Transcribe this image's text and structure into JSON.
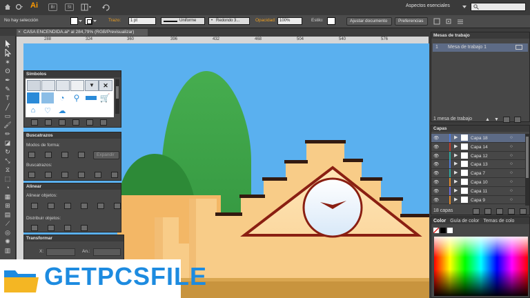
{
  "menubar": {
    "app_label": "Ai",
    "bridge_label": "Br",
    "stock_label": "St",
    "workspace": "Aspectos esenciales",
    "search_icon": "search-icon"
  },
  "control_bar": {
    "selection_status": "No hay selección",
    "stroke_label": "Trazo:",
    "stroke_weight": "1 pt",
    "profile_label": "Uniforme",
    "brush_label": "Redondo 3...",
    "opacity_label": "Opacidad:",
    "opacity_value": "100%",
    "style_label": "Estilo:",
    "document_setup_label": "Ajustar documento",
    "preferences_label": "Preferencias"
  },
  "document": {
    "tab_title": "CASA ENCENDIDA.ai* al 284,79% (RGB/Previsualizar)",
    "ruler_ticks": [
      "288",
      "324",
      "360",
      "396",
      "432",
      "468",
      "504",
      "540",
      "576"
    ]
  },
  "panels": {
    "symbols": {
      "title": "Símbolos"
    },
    "pathfinder": {
      "title": "Buscatrazos",
      "shape_modes_label": "Modos de forma:",
      "expand_label": "Expandir",
      "pathfinders_label": "Buscatrazos:"
    },
    "align": {
      "title": "Alinear",
      "align_objects_label": "Alinear objetos:",
      "distribute_objects_label": "Distribuir objetos:"
    },
    "transform": {
      "title": "Transformar",
      "x_label": "X:",
      "w_label": "An.:",
      "y_label": "Y:",
      "h_label": "Al.:"
    },
    "artboards": {
      "title": "Mesas de trabajo",
      "items": [
        {
          "index": "1",
          "name": "Mesa de trabajo 1"
        }
      ],
      "count_label": "1 mesa de trabajo"
    },
    "layers": {
      "title": "Capas",
      "items": [
        {
          "name": "Capa 18",
          "color": "#4f7bd8",
          "selected": true
        },
        {
          "name": "Capa 14",
          "color": "#c03c2c",
          "selected": false
        },
        {
          "name": "Capa 12",
          "color": "#2fa7a0",
          "selected": false
        },
        {
          "name": "Capa 13",
          "color": "#4f7bd8",
          "selected": false
        },
        {
          "name": "Capa 7",
          "color": "#2fa7a0",
          "selected": false
        },
        {
          "name": "Capa 10",
          "color": "#e08a2c",
          "selected": false
        },
        {
          "name": "Capa 11",
          "color": "#6c6cd8",
          "selected": false
        },
        {
          "name": "Capa 9",
          "color": "#e08a2c",
          "selected": false
        }
      ],
      "count_label": "18 capas"
    },
    "color": {
      "tabs": [
        "Color",
        "Guía de color",
        "Temas de colo"
      ]
    }
  },
  "watermark": {
    "text": "GETPCSFILE"
  },
  "colors": {
    "sky": "#5ab0ef",
    "hill": "#39a046",
    "building": "#f8cc88",
    "roof": "#331a10",
    "clock_frame": "#8a1f12",
    "watermark_blue": "#1d8be0"
  }
}
